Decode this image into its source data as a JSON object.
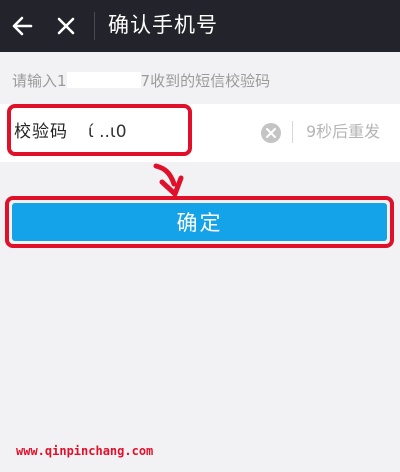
{
  "header": {
    "title": "确认手机号",
    "back_icon": "arrow-left-icon",
    "close_icon": "close-icon"
  },
  "hint": {
    "prefix": "请输入1",
    "suffix": "7收到的短信校验码"
  },
  "code_field": {
    "label": "校验码",
    "value": "ί ..ι0",
    "clear_icon": "clear-circle-icon",
    "resend_text": "9秒后重发"
  },
  "confirm_button": {
    "label": "确定"
  },
  "watermark": {
    "text": "www.qinpinchang.com"
  },
  "colors": {
    "header_bg": "#23242b",
    "page_bg": "#f2f2f4",
    "button_bg": "#14a2e8",
    "highlight": "#e0102a"
  }
}
